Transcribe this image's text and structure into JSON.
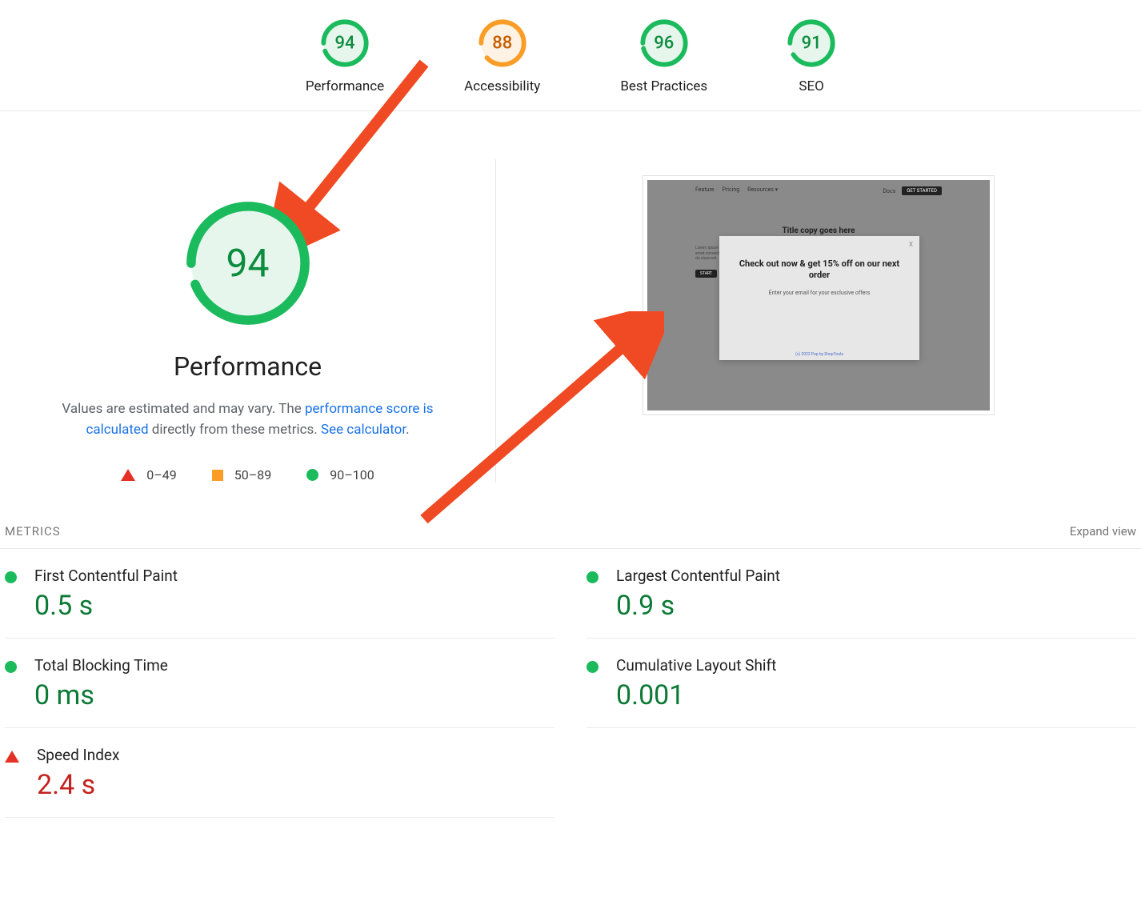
{
  "top_scores": [
    {
      "label": "Performance",
      "value": "94",
      "status": "green",
      "pct": 94
    },
    {
      "label": "Accessibility",
      "value": "88",
      "status": "orange",
      "pct": 88
    },
    {
      "label": "Best Practices",
      "value": "96",
      "status": "green",
      "pct": 96
    },
    {
      "label": "SEO",
      "value": "91",
      "status": "green",
      "pct": 91
    }
  ],
  "big_gauge": {
    "value": "94",
    "pct": 94,
    "title": "Performance"
  },
  "description": {
    "prefix": "Values are estimated and may vary. The ",
    "link1": "performance score is calculated",
    "mid": " directly from these metrics. ",
    "link2": "See calculator",
    "suffix": "."
  },
  "legend": [
    {
      "range": "0–49"
    },
    {
      "range": "50–89"
    },
    {
      "range": "90–100"
    }
  ],
  "thumbnail": {
    "nav": {
      "features": "Feature",
      "pricing": "Pricing",
      "resources": "Resources ▾",
      "docs": "Docs",
      "cta": "GET STARTED"
    },
    "title": "Title copy goes here",
    "lorem": "Lorem ipsum dolor sit amet consectetur elit sed do eiusmod.",
    "start": "START",
    "popup": {
      "close": "X",
      "headline": "Check out now & get 15% off on our next order",
      "sub": "Enter your email for your exclusive offers",
      "footer": "(c) 2022 Pop by ShopTools"
    }
  },
  "metrics_header": {
    "title": "METRICS",
    "expand": "Expand view"
  },
  "metrics": [
    {
      "name": "First Contentful Paint",
      "value": "0.5 s",
      "status": "good"
    },
    {
      "name": "Largest Contentful Paint",
      "value": "0.9 s",
      "status": "good"
    },
    {
      "name": "Total Blocking Time",
      "value": "0 ms",
      "status": "good"
    },
    {
      "name": "Cumulative Layout Shift",
      "value": "0.001",
      "status": "good"
    },
    {
      "name": "Speed Index",
      "value": "2.4 s",
      "status": "poor"
    }
  ],
  "colors": {
    "green": "#1bbb5d",
    "greenFill": "#e6f6ec",
    "orange": "#fa9d27",
    "orangeFill": "#fdf2e3"
  }
}
